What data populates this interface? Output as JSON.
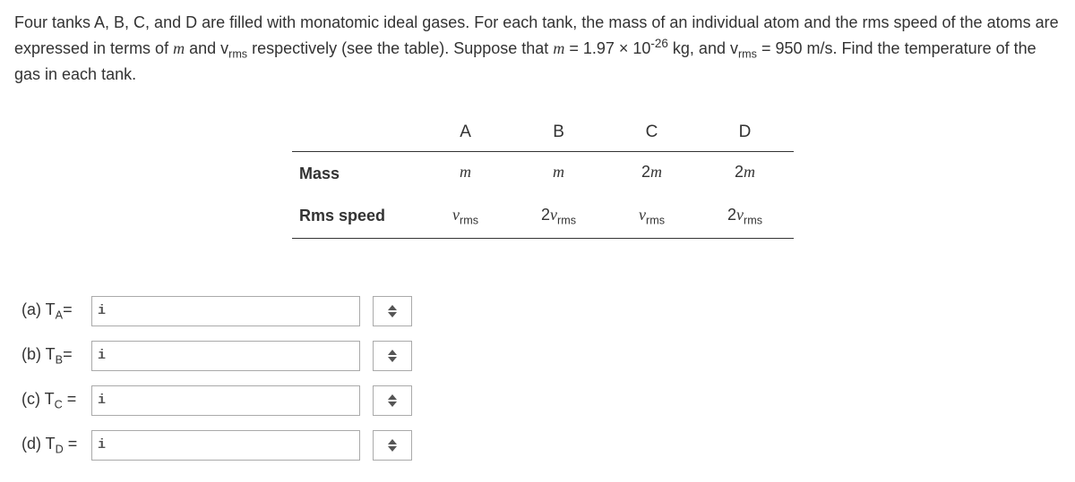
{
  "problem": {
    "line1_a": "Four tanks A, B, C, and D are filled with monatomic ideal gases. For each tank, the mass of an individual atom and the rms speed of the",
    "line1_b": "atoms are expressed in terms of ",
    "mvar": "m",
    "and1": " and v",
    "rms1": "rms",
    "mid": " respectively (see the table). Suppose that ",
    "eq_m_lhs": "m",
    "eq_m": " = 1.97 × 10",
    "exp": "-26",
    "eq_m_tail": " kg, and v",
    "rms2": "rms",
    "eq_v": " = 950 m/s. Find the",
    "line3": "temperature of the gas in each tank."
  },
  "table": {
    "headers": [
      "",
      "A",
      "B",
      "C",
      "D"
    ],
    "rows": [
      {
        "head": "Mass",
        "cells": [
          {
            "pre": "",
            "var": "m",
            "sub": ""
          },
          {
            "pre": "",
            "var": "m",
            "sub": ""
          },
          {
            "pre": "2",
            "var": "m",
            "sub": ""
          },
          {
            "pre": "2",
            "var": "m",
            "sub": ""
          }
        ]
      },
      {
        "head": "Rms speed",
        "cells": [
          {
            "pre": "",
            "var": "v",
            "sub": "rms"
          },
          {
            "pre": "2",
            "var": "v",
            "sub": "rms"
          },
          {
            "pre": "",
            "var": "v",
            "sub": "rms"
          },
          {
            "pre": "2",
            "var": "v",
            "sub": "rms"
          }
        ]
      }
    ]
  },
  "answers": [
    {
      "label_a": "(a) T",
      "label_sub": "A",
      "label_eq": "="
    },
    {
      "label_a": "(b) T",
      "label_sub": "B",
      "label_eq": "="
    },
    {
      "label_a": "(c) T",
      "label_sub": "C",
      "label_eq": " ="
    },
    {
      "label_a": "(d) T",
      "label_sub": "D",
      "label_eq": " ="
    }
  ],
  "icons": {
    "info": "i"
  }
}
